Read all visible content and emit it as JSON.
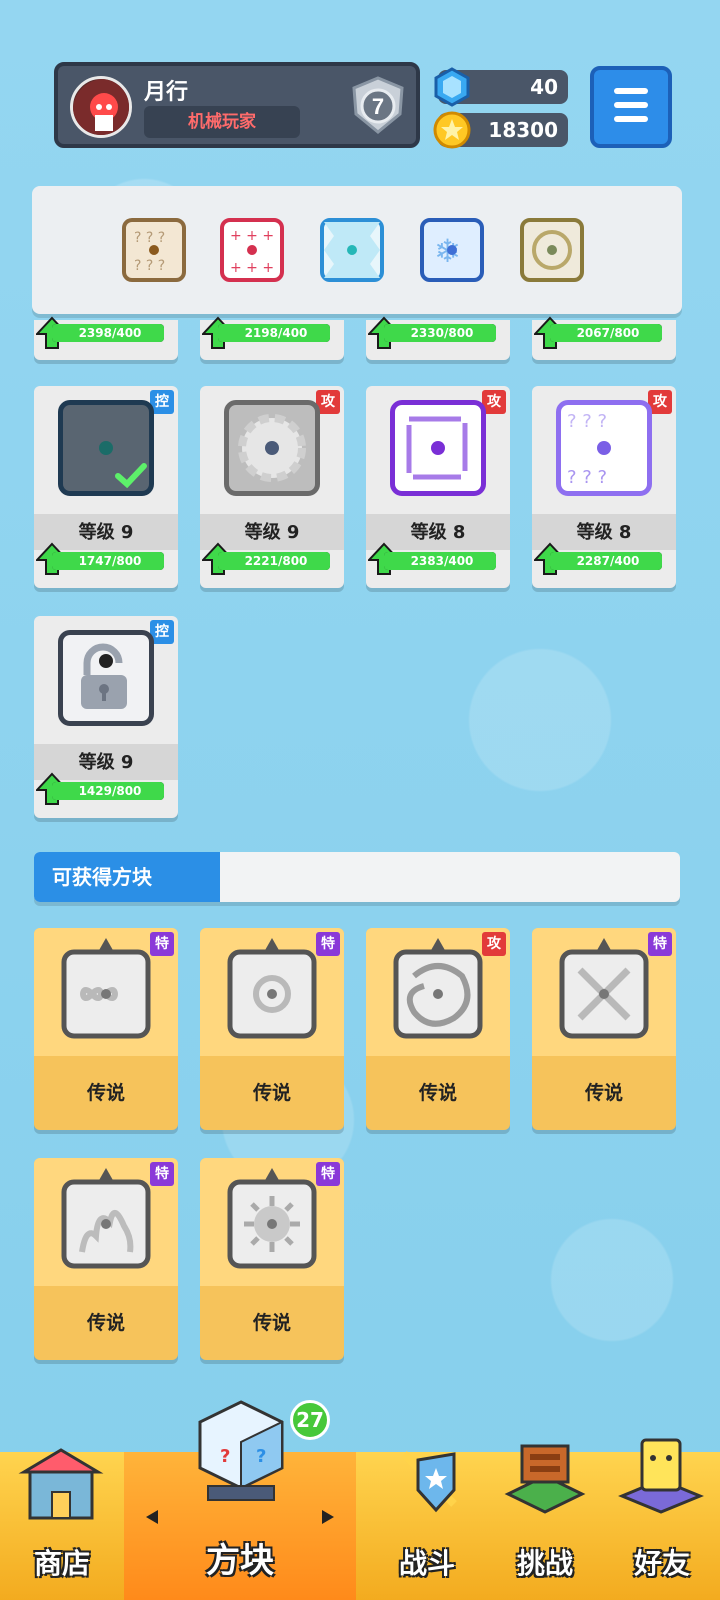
{
  "player": {
    "name": "月行",
    "title": "机械玩家",
    "rank": "7"
  },
  "currency": {
    "gems": "40",
    "coins": "18300"
  },
  "colors": {
    "accent": "#2b8fe6",
    "legendary": "#f6c35b",
    "progress": "#3fd94a"
  },
  "top_progress": [
    "2398/400",
    "2198/400",
    "2330/800",
    "2067/800"
  ],
  "owned_cards": [
    {
      "tag": "控",
      "level": "等级 9",
      "progress": "1747/800",
      "progress_fraction": 1.0,
      "selected": true
    },
    {
      "tag": "攻",
      "level": "等级 9",
      "progress": "2221/800",
      "progress_fraction": 1.0
    },
    {
      "tag": "攻",
      "level": "等级 8",
      "progress": "2383/400",
      "progress_fraction": 1.0
    },
    {
      "tag": "攻",
      "level": "等级 8",
      "progress": "2287/400",
      "progress_fraction": 1.0
    },
    {
      "tag": "控",
      "level": "等级 9",
      "progress": "1429/800",
      "progress_fraction": 1.0
    }
  ],
  "available_section": {
    "title": "可获得方块"
  },
  "available_cards": [
    {
      "tag": "特",
      "label": "传说"
    },
    {
      "tag": "特",
      "label": "传说"
    },
    {
      "tag": "攻",
      "label": "传说"
    },
    {
      "tag": "特",
      "label": "传说"
    },
    {
      "tag": "特",
      "label": "传说"
    },
    {
      "tag": "特",
      "label": "传说"
    }
  ],
  "nav": {
    "shop": "商店",
    "dice": "方块",
    "battle": "战斗",
    "challenge": "挑战",
    "friends": "好友",
    "dice_badge": "27"
  }
}
